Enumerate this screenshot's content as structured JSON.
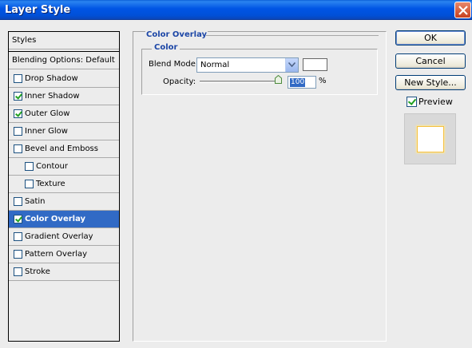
{
  "window": {
    "title": "Layer Style"
  },
  "styles_list": {
    "header": "Styles",
    "blending": "Blending Options: Default",
    "items": [
      {
        "label": "Drop Shadow",
        "checked": false
      },
      {
        "label": "Inner Shadow",
        "checked": true
      },
      {
        "label": "Outer Glow",
        "checked": true
      },
      {
        "label": "Inner Glow",
        "checked": false
      },
      {
        "label": "Bevel and Emboss",
        "checked": false
      },
      {
        "label": "Contour",
        "checked": false,
        "indent": true
      },
      {
        "label": "Texture",
        "checked": false,
        "indent": true
      },
      {
        "label": "Satin",
        "checked": false
      },
      {
        "label": "Color Overlay",
        "checked": true,
        "selected": true
      },
      {
        "label": "Gradient Overlay",
        "checked": false
      },
      {
        "label": "Pattern Overlay",
        "checked": false
      },
      {
        "label": "Stroke",
        "checked": false
      }
    ]
  },
  "panel": {
    "title": "Color Overlay",
    "group": "Color",
    "blend_mode_label": "Blend Mode:",
    "blend_mode_value": "Normal",
    "overlay_color": "#ffffff",
    "opacity_label": "Opacity:",
    "opacity_value": "100",
    "opacity_unit": "%",
    "opacity_fraction": 1.0
  },
  "buttons": {
    "ok": "OK",
    "cancel": "Cancel",
    "new_style": "New Style...",
    "preview_label": "Preview",
    "preview_checked": true
  },
  "colors": {
    "titlebar": "#0055e5",
    "selection": "#316ac5",
    "group_title": "#1c46a6"
  }
}
